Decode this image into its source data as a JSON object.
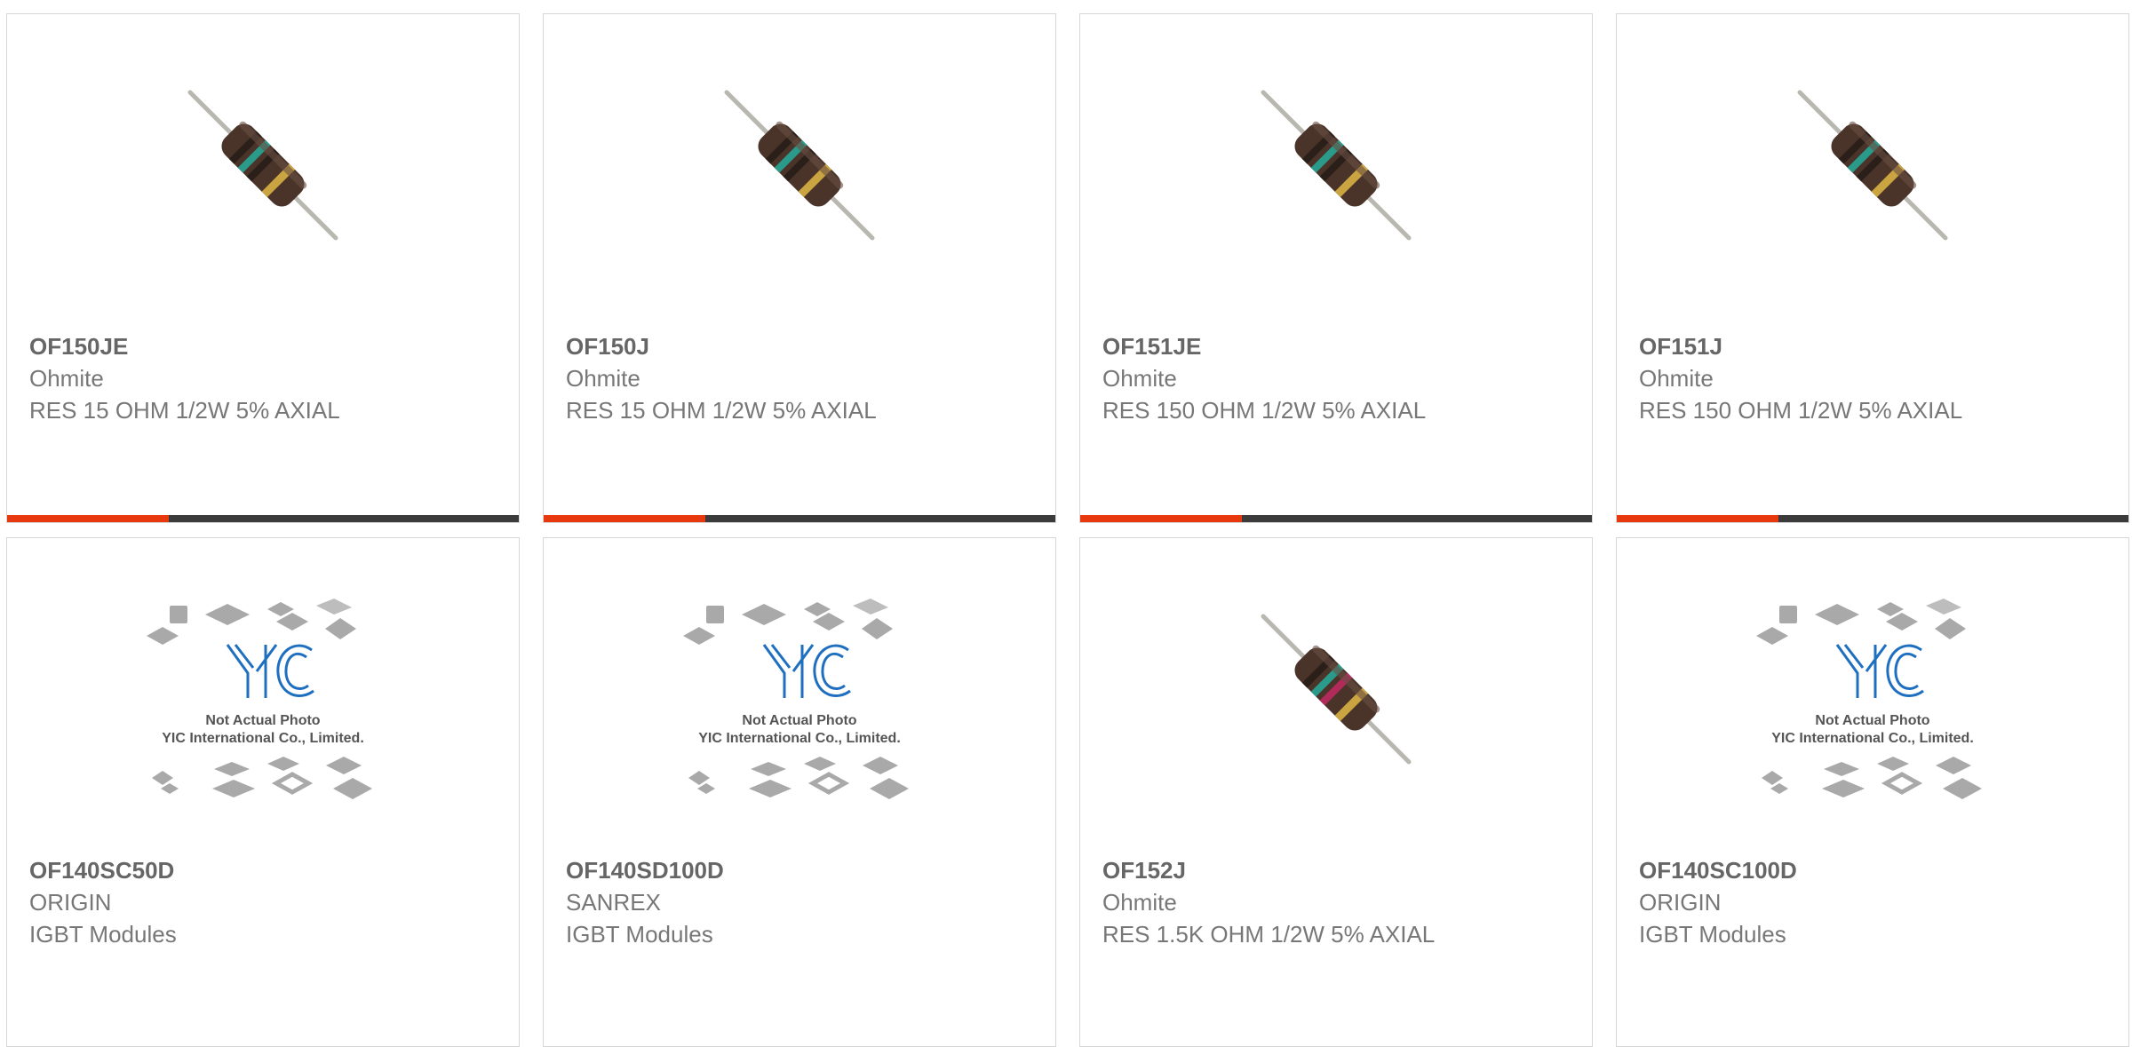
{
  "accent_color": "#e8380d",
  "bar_color": "#3b3b3b",
  "products": [
    {
      "part_number": "OF150JE",
      "manufacturer": "Ohmite",
      "description": "RES 15 OHM 1/2W 5% AXIAL",
      "image": "resistor-image",
      "band3": "#2a9a8a"
    },
    {
      "part_number": "OF150J",
      "manufacturer": "Ohmite",
      "description": "RES 15 OHM 1/2W 5% AXIAL",
      "image": "resistor-image",
      "band3": "#2a9a8a"
    },
    {
      "part_number": "OF151JE",
      "manufacturer": "Ohmite",
      "description": "RES 150 OHM 1/2W 5% AXIAL",
      "image": "resistor-image",
      "band3": "#2a9a8a"
    },
    {
      "part_number": "OF151J",
      "manufacturer": "Ohmite",
      "description": "RES 150 OHM 1/2W 5% AXIAL",
      "image": "resistor-image",
      "band3": "#2a9a8a"
    },
    {
      "part_number": "OF140SC50D",
      "manufacturer": "ORIGIN",
      "description": "IGBT Modules",
      "image": "not-actual-photo-placeholder"
    },
    {
      "part_number": "OF140SD100D",
      "manufacturer": "SANREX",
      "description": "IGBT Modules",
      "image": "not-actual-photo-placeholder"
    },
    {
      "part_number": "OF152J",
      "manufacturer": "Ohmite",
      "description": "RES 1.5K OHM 1/2W 5% AXIAL",
      "image": "resistor-image",
      "band3": "#b02a5a"
    },
    {
      "part_number": "OF140SC100D",
      "manufacturer": "ORIGIN",
      "description": "IGBT Modules",
      "image": "not-actual-photo-placeholder"
    }
  ],
  "placeholder": {
    "logo_text": "YIC",
    "line1": "Not Actual Photo",
    "line2": "YIC International Co., Limited."
  }
}
